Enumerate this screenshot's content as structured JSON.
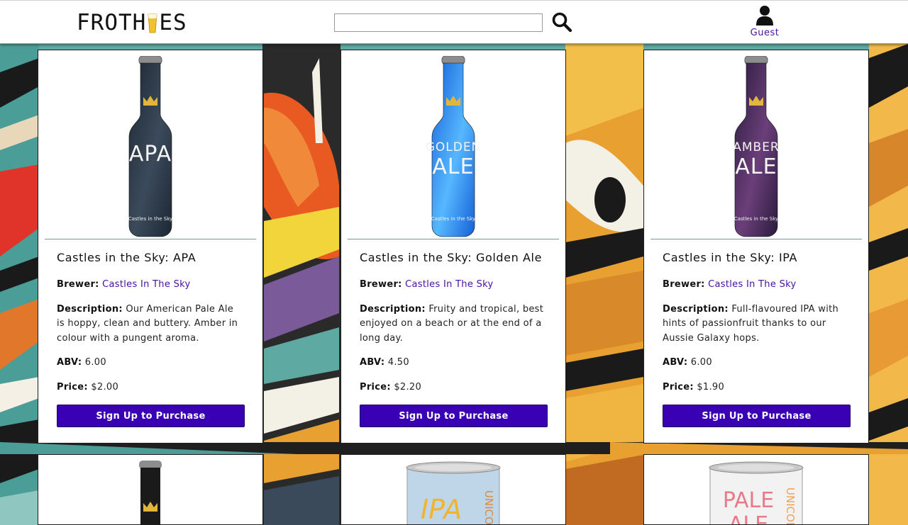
{
  "header": {
    "logo_left": "FROTH",
    "logo_right": "ES",
    "search": {
      "value": "",
      "placeholder": ""
    },
    "user": {
      "name": "Guest"
    }
  },
  "products": [
    {
      "title": "Castles in the Sky: APA",
      "label_lines": [
        "APA"
      ],
      "brand_mark": "Castles in the Sky",
      "brewer_label": "Brewer:",
      "brewer": "Castles In The Sky",
      "description_label": "Description:",
      "description": "Our American Pale Ale is hoppy, clean and buttery. Amber in colour with a pungent aroma.",
      "abv_label": "ABV:",
      "abv": "6.00",
      "price_label": "Price:",
      "price": "$2.00",
      "button": "Sign Up to Purchase",
      "bottle_colors": [
        "#1d2734",
        "#3b4a5a",
        "#c9a233"
      ]
    },
    {
      "title": "Castles in the Sky: Golden Ale",
      "label_lines": [
        "GOLDEN",
        "ALE"
      ],
      "brand_mark": "Castles in the Sky",
      "brewer_label": "Brewer:",
      "brewer": "Castles In The Sky",
      "description_label": "Description:",
      "description": "Fruity and tropical, best enjoyed on a beach or at the end of a long day.",
      "abv_label": "ABV:",
      "abv": "4.50",
      "price_label": "Price:",
      "price": "$2.20",
      "button": "Sign Up to Purchase",
      "bottle_colors": [
        "#1560d6",
        "#56b8ff",
        "#9fe2ff"
      ]
    },
    {
      "title": "Castles in the Sky: IPA",
      "label_lines": [
        "AMBER",
        "ALE"
      ],
      "brand_mark": "Castles in the Sky",
      "brewer_label": "Brewer:",
      "brewer": "Castles In The Sky",
      "description_label": "Description:",
      "description": "Full-flavoured IPA with hints of passionfruit thanks to our Aussie Galaxy hops.",
      "abv_label": "ABV:",
      "abv": "6.00",
      "price_label": "Price:",
      "price": "$1.90",
      "button": "Sign Up to Purchase",
      "bottle_colors": [
        "#2a1b3d",
        "#6b3f7a",
        "#b27a9a"
      ]
    }
  ],
  "partial_products": [
    {
      "label_lines": [],
      "kind": "bottle"
    },
    {
      "label_lines": [
        "IPA",
        "UNICO"
      ],
      "kind": "can"
    },
    {
      "label_lines": [
        "PALE",
        "ALE",
        "UNICOR"
      ],
      "kind": "can"
    }
  ],
  "colors": {
    "accent": "#3a00b4",
    "link": "#4a0fa3",
    "crown": "#e3b53a"
  }
}
